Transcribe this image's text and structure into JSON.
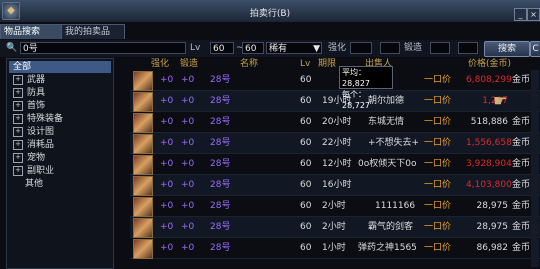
{
  "window": {
    "title": "拍卖行(B)"
  },
  "tabs": [
    {
      "label": "物品搜索"
    },
    {
      "label": "我的拍卖品"
    }
  ],
  "search": {
    "query": "0号",
    "lv_label": "Lv",
    "lv_min": "60",
    "lv_max": "60",
    "rarity": "稀有",
    "enhance_label": "强化",
    "forge_label": "锻造",
    "search_button": "搜索",
    "clear_button": "C"
  },
  "categories": [
    {
      "label": "全部",
      "selected": true,
      "pm": ""
    },
    {
      "label": "武器",
      "pm": "+"
    },
    {
      "label": "防具",
      "pm": "+"
    },
    {
      "label": "首饰",
      "pm": "+"
    },
    {
      "label": "特殊装备",
      "pm": "+"
    },
    {
      "label": "设计图",
      "pm": "+"
    },
    {
      "label": "消耗品",
      "pm": "+"
    },
    {
      "label": "宠物",
      "pm": "+"
    },
    {
      "label": "副职业",
      "pm": "+"
    },
    {
      "label": "其他",
      "pm": ""
    }
  ],
  "table": {
    "headers": {
      "enhance": "强化",
      "forge": "锻造",
      "name": "名称",
      "lv": "Lv",
      "time": "期限",
      "seller": "出售人",
      "price": "价格(金币)"
    },
    "rows": [
      {
        "enhance": "+0",
        "forge": "+0",
        "name": "28号",
        "lv": "60",
        "time": "",
        "seller": "",
        "buyout": "一口价",
        "price": "6,808,299",
        "currency": "金币"
      },
      {
        "enhance": "+0",
        "forge": "+0",
        "name": "28号",
        "lv": "60",
        "time": "19小时",
        "seller": "朝尔加德",
        "buyout": "一口价",
        "price": "1,297",
        "currency": ""
      },
      {
        "enhance": "+0",
        "forge": "+0",
        "name": "28号",
        "lv": "60",
        "time": "20小时",
        "seller": "东城无情",
        "buyout": "一口价",
        "price": "518,886",
        "currency": "金币"
      },
      {
        "enhance": "+0",
        "forge": "+0",
        "name": "28号",
        "lv": "60",
        "time": "22小时",
        "seller": "+不想失去+",
        "buyout": "一口价",
        "price": "1,556,658",
        "currency": "金币"
      },
      {
        "enhance": "+0",
        "forge": "+0",
        "name": "28号",
        "lv": "60",
        "time": "12小时",
        "seller": "0o权倾天下0o",
        "buyout": "一口价",
        "price": "3,928,904",
        "currency": "金币"
      },
      {
        "enhance": "+0",
        "forge": "+0",
        "name": "28号",
        "lv": "60",
        "time": "16小时",
        "seller": "",
        "buyout": "一口价",
        "price": "4,103,800",
        "currency": "金币"
      },
      {
        "enhance": "+0",
        "forge": "+0",
        "name": "28号",
        "lv": "60",
        "time": "2小时",
        "seller": "1111166",
        "buyout": "一口价",
        "price": "28,975",
        "currency": "金币"
      },
      {
        "enhance": "+0",
        "forge": "+0",
        "name": "28号",
        "lv": "60",
        "time": "2小时",
        "seller": "霸气的剑客",
        "buyout": "一口价",
        "price": "28,975",
        "currency": "金币"
      },
      {
        "enhance": "+0",
        "forge": "+0",
        "name": "28号",
        "lv": "60",
        "time": "1小时",
        "seller": "弹药之神1565",
        "buyout": "一口价",
        "price": "86,982",
        "currency": "金币"
      }
    ]
  },
  "tooltip": {
    "avg_label": "平均：",
    "avg": "28,827",
    "each_label": "每个：",
    "each": "28,727"
  }
}
